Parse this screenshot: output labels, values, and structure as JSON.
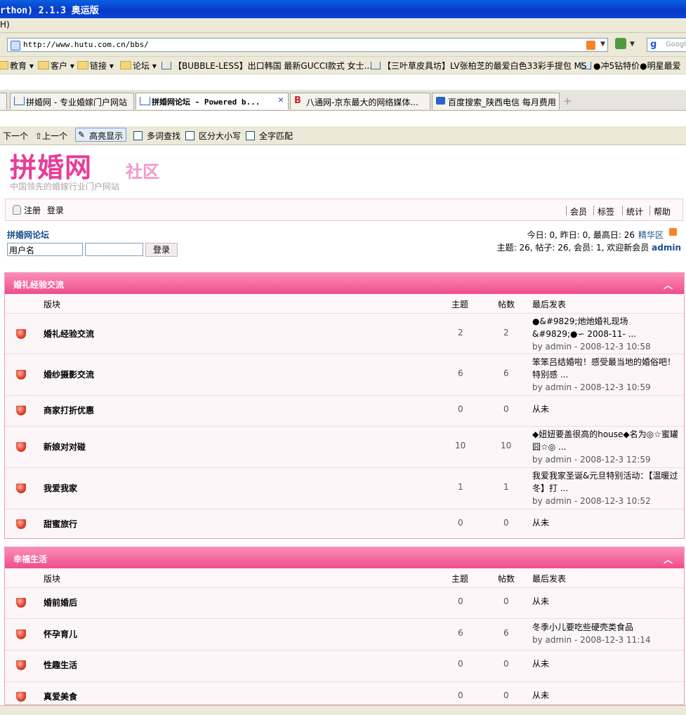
{
  "window": {
    "title": "rthon) 2.1.3 奥运版"
  },
  "menubar": {
    "label": "H)"
  },
  "address": {
    "url": "http://www.hutu.com.cn/bbs/",
    "search_placeholder": "Googl"
  },
  "links": [
    "教育",
    "客户",
    "链接",
    "论坛",
    "【BUBBLE-LESS】出口韩国 最新GUCCI款式 女士...",
    "【三叶草皮具坊】LV张柏芝的最爱白色33彩手提包 MS",
    "●冲5钻特价●明星最爱"
  ],
  "tabs": [
    {
      "label": "拼婚网 - 专业婚嫁门户网站"
    },
    {
      "label": "拼婚网论坛 - Powered b..."
    },
    {
      "label": "八通网-京东最大的网络媒体..."
    },
    {
      "label": "百度搜索_陕西电信 每月费用"
    }
  ],
  "findbar": {
    "next": "下一个",
    "prev": "上一个",
    "highlight": "高亮显示",
    "multi": "多词查找",
    "case": "区分大小写",
    "whole": "全字匹配"
  },
  "site": {
    "logo_main": "拼婚网",
    "logo_sub": "社区",
    "slogan": "中国领先的婚嫁行业门户网站",
    "register": "注册",
    "login": "登录",
    "nav": [
      "会员",
      "标签",
      "统计",
      "帮助"
    ],
    "forum_title": "拼婚网论坛",
    "username_value": "用户名",
    "login_button": "登录",
    "stats_line1": "今日: 0, 昨日: 0, 最高日: 26",
    "digest": "精华区",
    "stats_line2": "主题: 26, 帖子: 26, 会员: 1, 欢迎新会员",
    "newest_member": "admin"
  },
  "columns": {
    "forum": "版块",
    "topics": "主题",
    "posts": "帖数",
    "last": "最后发表"
  },
  "categories": [
    {
      "title": "婚礼经验交流",
      "forums": [
        {
          "name": "婚礼经验交流",
          "topics": "2",
          "posts": "2",
          "last_title": "●&#9829;灺灺婚礼现场&#9829;●∽ 2008-11- ...",
          "last_by": "by admin - 2008-12-3 10:58"
        },
        {
          "name": "婚纱摄影交流",
          "topics": "6",
          "posts": "6",
          "last_title": "笨笨吕结婚啦！感受最当地的婚俗吧！特别感 ...",
          "last_by": "by admin - 2008-12-3 10:59"
        },
        {
          "name": "商家打折优惠",
          "topics": "0",
          "posts": "0",
          "last_title": "从未",
          "last_by": ""
        },
        {
          "name": "新娘对对碰",
          "topics": "10",
          "posts": "10",
          "last_title": "◆妞妞要盖很高的house◆名为◎☆蜜罐囧☆◎ ...",
          "last_by": "by admin - 2008-12-3 12:59"
        },
        {
          "name": "我爱我家",
          "topics": "1",
          "posts": "1",
          "last_title": "我爱我家圣诞&元旦特别活动：【温暖过冬】打 ...",
          "last_by": "by admin - 2008-12-3 10:52"
        },
        {
          "name": "甜蜜旅行",
          "topics": "0",
          "posts": "0",
          "last_title": "从未",
          "last_by": ""
        }
      ]
    },
    {
      "title": "幸福生活",
      "forums": [
        {
          "name": "婚前婚后",
          "topics": "0",
          "posts": "0",
          "last_title": "从未",
          "last_by": ""
        },
        {
          "name": "怀孕育儿",
          "topics": "6",
          "posts": "6",
          "last_title": "冬季小儿要吃些硬壳类食品",
          "last_by": "by admin - 2008-12-3 11:14"
        },
        {
          "name": "性趣生活",
          "topics": "0",
          "posts": "0",
          "last_title": "从未",
          "last_by": ""
        },
        {
          "name": "真爱美食",
          "topics": "0",
          "posts": "0",
          "last_title": "从未",
          "last_by": ""
        }
      ]
    }
  ]
}
